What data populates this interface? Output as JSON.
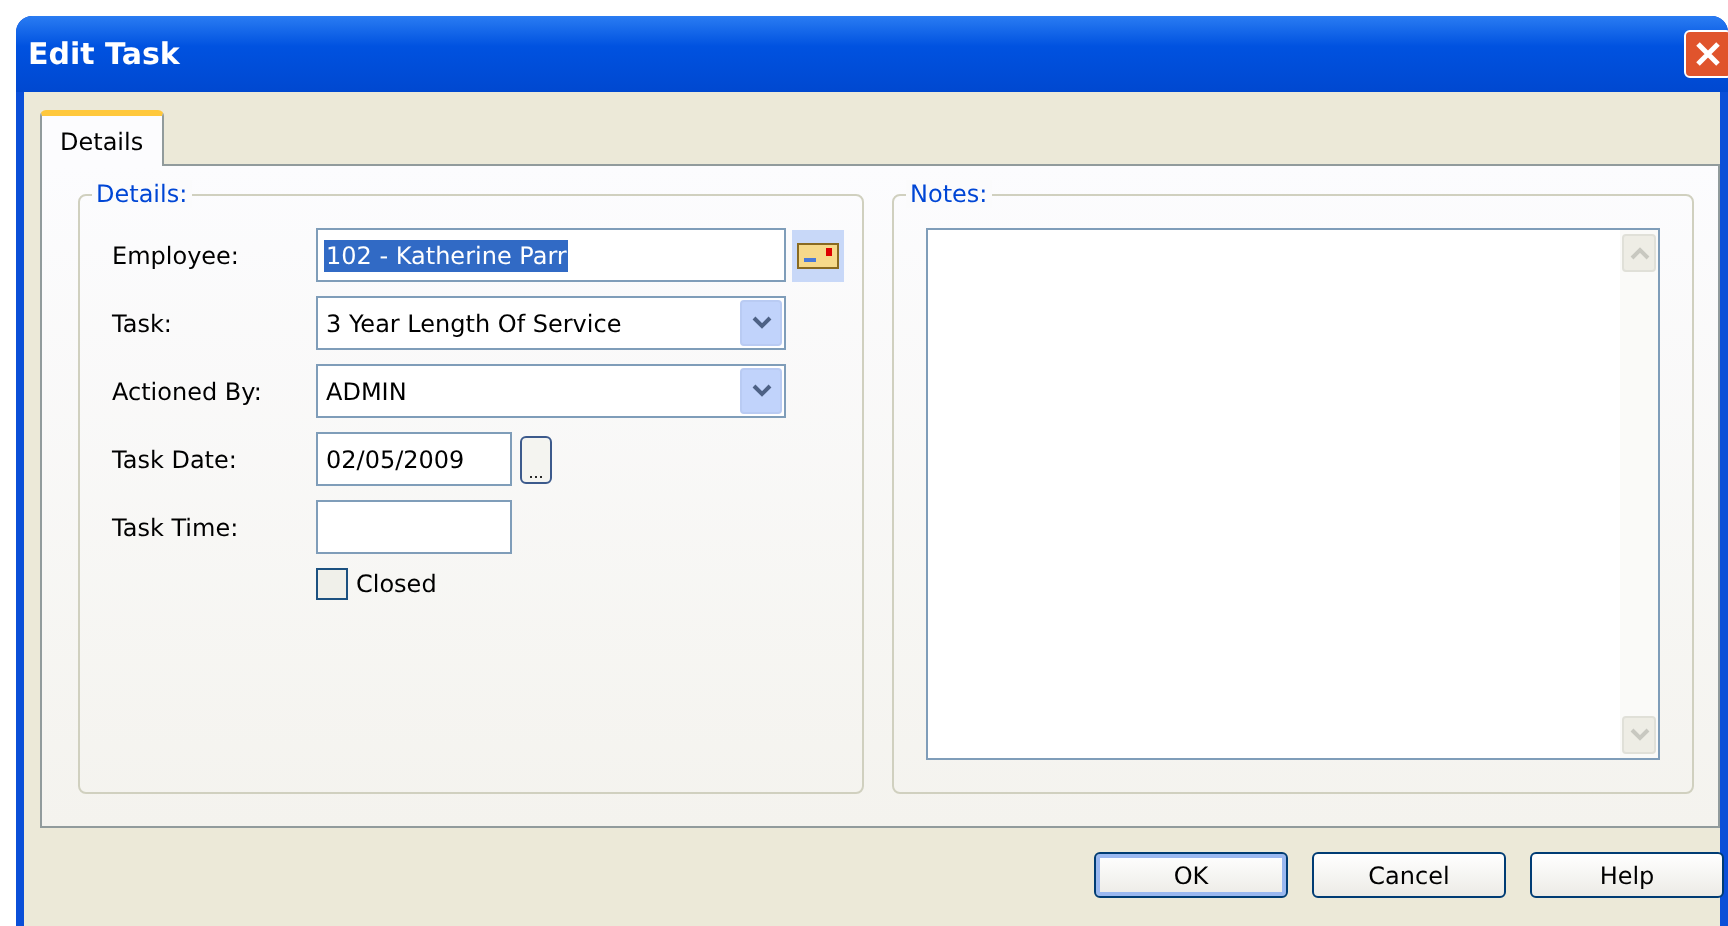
{
  "window": {
    "title": "Edit Task"
  },
  "tabs": [
    {
      "label": "Details",
      "selected": true
    }
  ],
  "details": {
    "legend": "Details:",
    "fields": [
      {
        "kind": "lookup",
        "label": "Employee:",
        "value": "102 - Katherine Parr",
        "highlighted": true
      },
      {
        "kind": "dropdown",
        "label": "Task:",
        "value": "3 Year Length Of Service"
      },
      {
        "kind": "dropdown",
        "label": "Actioned By:",
        "value": "ADMIN"
      },
      {
        "kind": "date",
        "label": "Task Date:",
        "value": "02/05/2009",
        "button": "..."
      },
      {
        "kind": "text",
        "label": "Task Time:"
      }
    ],
    "closed": {
      "label": "Closed",
      "checked": false
    }
  },
  "notes": {
    "legend": "Notes:"
  },
  "buttons": [
    {
      "label": "OK",
      "default": true
    },
    {
      "label": "Cancel",
      "default": false
    },
    {
      "label": "Help",
      "default": false
    }
  ]
}
